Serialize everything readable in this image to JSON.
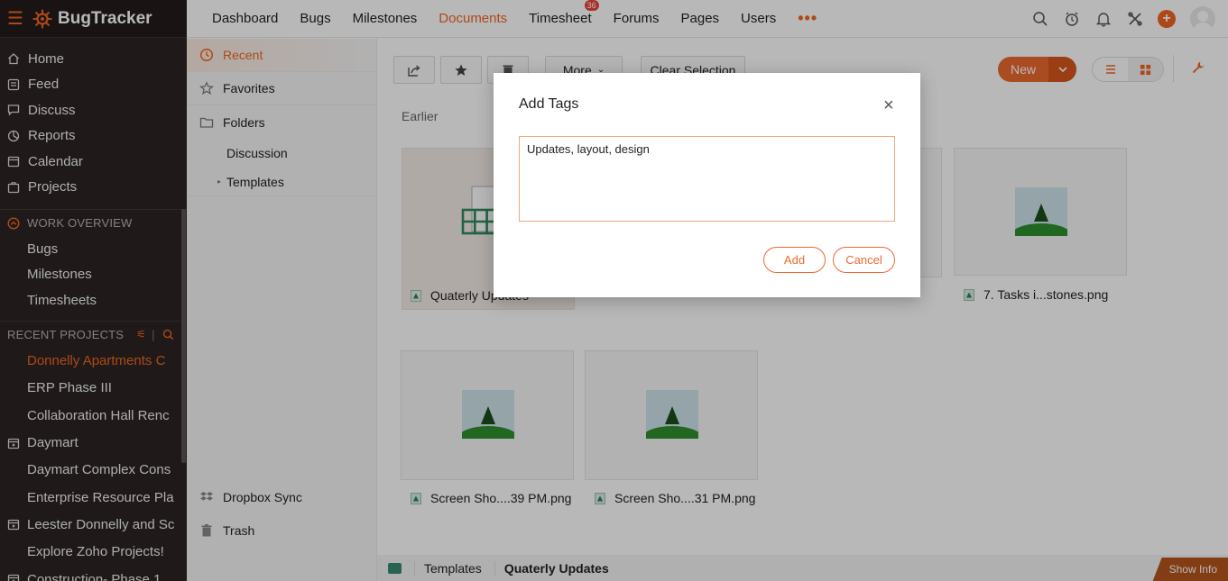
{
  "app": {
    "name": "BugTracker"
  },
  "sidebar": {
    "items": [
      {
        "label": "Home",
        "icon": "home-icon"
      },
      {
        "label": "Feed",
        "icon": "feed-icon"
      },
      {
        "label": "Discuss",
        "icon": "discuss-icon"
      },
      {
        "label": "Reports",
        "icon": "reports-icon"
      },
      {
        "label": "Calendar",
        "icon": "calendar-icon"
      },
      {
        "label": "Projects",
        "icon": "projects-icon"
      }
    ],
    "work_overview": {
      "title": "WORK OVERVIEW",
      "items": [
        "Bugs",
        "Milestones",
        "Timesheets"
      ]
    },
    "recent_projects": {
      "title": "RECENT PROJECTS",
      "items": [
        {
          "label": "Donnelly Apartments C",
          "active": true,
          "icon": ""
        },
        {
          "label": "ERP Phase III",
          "icon": ""
        },
        {
          "label": "Collaboration Hall Renc",
          "icon": ""
        },
        {
          "label": "Daymart",
          "icon": "project-group-icon"
        },
        {
          "label": "Daymart Complex Cons",
          "icon": ""
        },
        {
          "label": "Enterprise Resource Pla",
          "icon": ""
        },
        {
          "label": "Leester Donnelly and Sc",
          "icon": "project-group-icon"
        },
        {
          "label": "Explore Zoho Projects!",
          "icon": ""
        },
        {
          "label": "Construction- Phase 1",
          "icon": "project-group-icon"
        }
      ]
    }
  },
  "topnav": {
    "tabs": [
      "Dashboard",
      "Bugs",
      "Milestones",
      "Documents",
      "Timesheet",
      "Forums",
      "Pages",
      "Users"
    ],
    "active_tab": "Documents",
    "timesheet_badge": "36",
    "more": "•••"
  },
  "docnav": {
    "recent": "Recent",
    "favorites": "Favorites",
    "folders": "Folders",
    "subfolders": [
      "Discussion",
      "Templates"
    ],
    "dropbox": "Dropbox Sync",
    "trash": "Trash"
  },
  "toolbar": {
    "more": "More",
    "clear_selection": "Clear Selection",
    "new": "New"
  },
  "main": {
    "section": "Earlier",
    "files": [
      {
        "name": "Quaterly Updates"
      },
      {
        "name": "7. Tasks i...stones.png"
      },
      {
        "name": "Screen Sho....39 PM.png"
      },
      {
        "name": "Screen Sho....31 PM.png"
      }
    ],
    "breadcrumb": [
      "Templates",
      "Quaterly Updates"
    ],
    "show_info": "Show Info"
  },
  "modal": {
    "title": "Add Tags",
    "value": "Updates, layout, design",
    "add": "Add",
    "cancel": "Cancel"
  },
  "colors": {
    "accent": "#f26522",
    "sidebar_bg": "#2c2523"
  }
}
